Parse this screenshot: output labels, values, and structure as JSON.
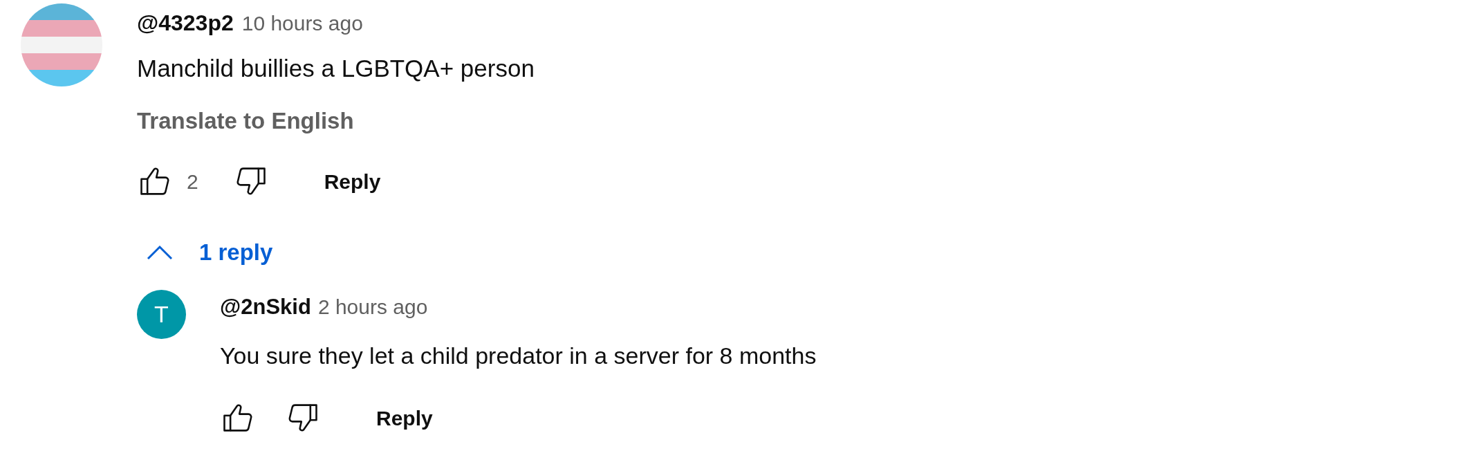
{
  "comment": {
    "author": "@4323p2",
    "time": "10 hours ago",
    "text": "Manchild buillies a LGBTQA+ person",
    "translate": "Translate to English",
    "likes": "2",
    "reply_button": "Reply",
    "replies_toggle": {
      "label": "1 reply",
      "expanded": true
    },
    "replies": [
      {
        "avatar_letter": "T",
        "author": "@2nSkid",
        "time": "2 hours ago",
        "text": "You sure they let a child predator in a server for 8 months",
        "reply_button": "Reply"
      }
    ]
  }
}
